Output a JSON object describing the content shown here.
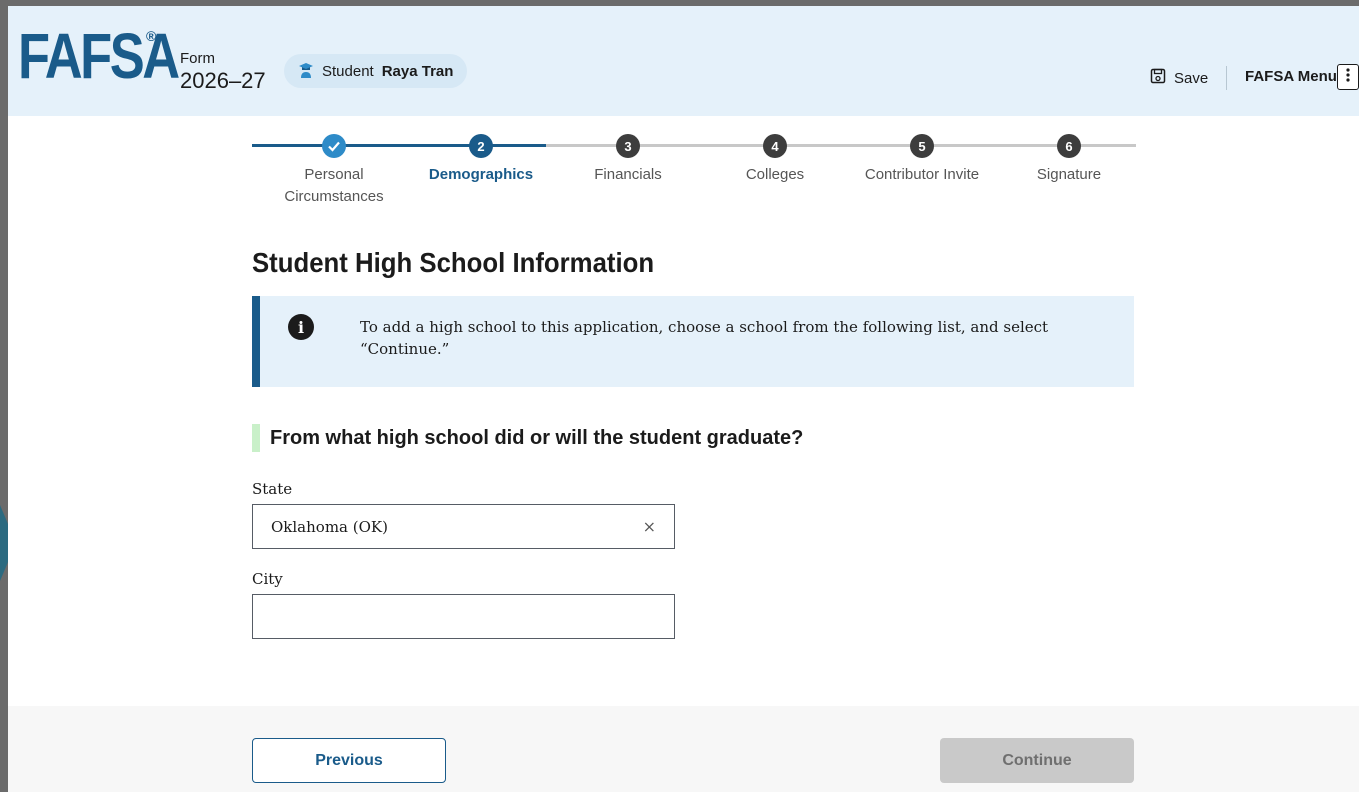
{
  "header": {
    "logo": "FAFSA",
    "logo_mark": "®",
    "form_label": "Form",
    "form_year": "2026–27",
    "student_prefix": "Student",
    "student_name": "Raya Tran",
    "save_label": "Save",
    "menu_label": "FAFSA Menu"
  },
  "steps": [
    {
      "number": "",
      "label": "Personal Circumstances",
      "state": "done"
    },
    {
      "number": "2",
      "label": "Demographics",
      "state": "current"
    },
    {
      "number": "3",
      "label": "Financials",
      "state": "upcoming"
    },
    {
      "number": "4",
      "label": "Colleges",
      "state": "upcoming"
    },
    {
      "number": "5",
      "label": "Contributor Invite",
      "state": "upcoming"
    },
    {
      "number": "6",
      "label": "Signature",
      "state": "upcoming"
    }
  ],
  "main": {
    "title": "Student High School Information",
    "info_text": "To add a high school to this application, choose a school from the following list, and select “Continue.”",
    "question": "From what high school did or will the student graduate?",
    "state_label": "State",
    "state_value": "Oklahoma (OK)",
    "clear_symbol": "×",
    "city_label": "City",
    "city_value": ""
  },
  "footer": {
    "previous_label": "Previous",
    "continue_label": "Continue"
  },
  "colors": {
    "brand": "#1a5b8a",
    "header_bg": "#e5f1fa",
    "question_marker": "#c9f0c9",
    "disabled_button": "#c9c9c9"
  }
}
